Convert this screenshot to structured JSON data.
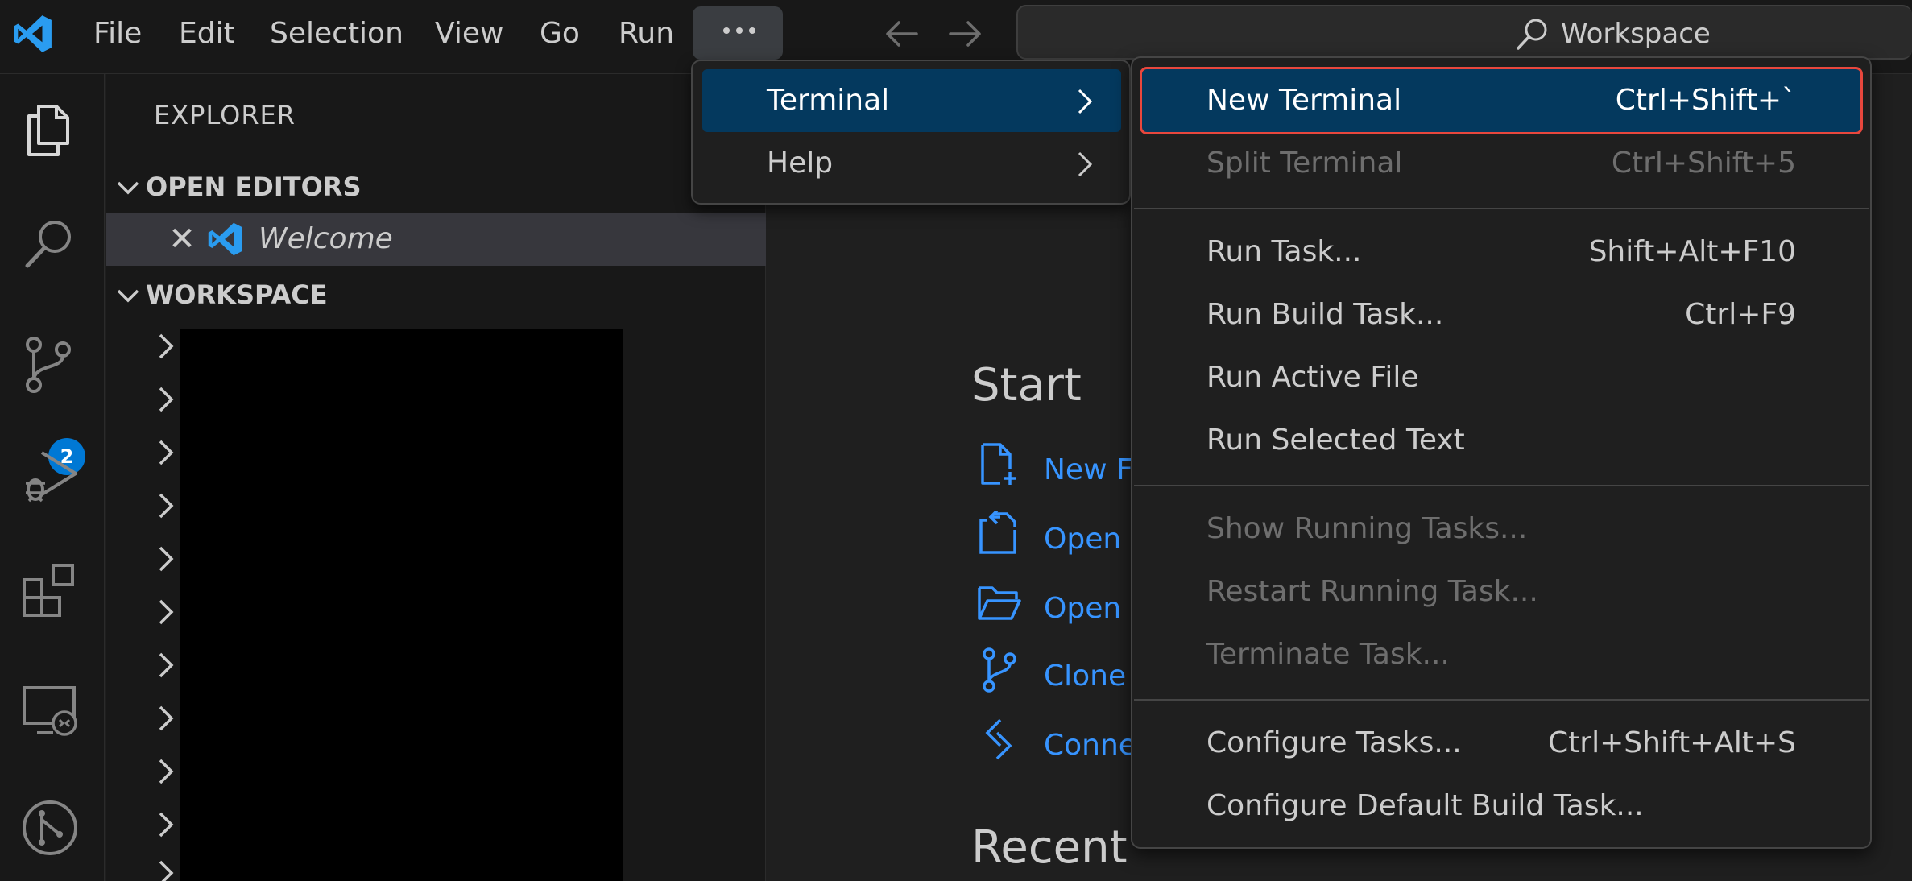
{
  "colors": {
    "accent": "#0078d4",
    "link": "#3794ff",
    "menu_highlight": "#04395e",
    "focus_outline": "#e8473d"
  },
  "titlebar": {
    "menus": [
      "File",
      "Edit",
      "Selection",
      "View",
      "Go",
      "Run"
    ],
    "search_label": "Workspace"
  },
  "activitybar": {
    "icons": [
      "explorer-icon",
      "search-icon",
      "source-control-icon",
      "run-debug-icon",
      "extensions-icon",
      "remote-explorer-icon",
      "git-graph-icon"
    ],
    "scm_badge": "2"
  },
  "sidebar": {
    "title": "EXPLORER",
    "open_editors_label": "OPEN EDITORS",
    "open_editor_item": "Welcome",
    "workspace_label": "WORKSPACE"
  },
  "welcome": {
    "start_heading": "Start",
    "links": [
      "New F",
      "Open",
      "Open",
      "Clone",
      "Conne"
    ],
    "recent_heading": "Recent"
  },
  "more_menu": {
    "items": [
      {
        "label": "Terminal"
      },
      {
        "label": "Help"
      }
    ]
  },
  "terminal_menu": {
    "items": [
      {
        "label": "New Terminal",
        "shortcut": "Ctrl+Shift+`"
      },
      {
        "label": "Split Terminal",
        "shortcut": "Ctrl+Shift+5"
      },
      {
        "label": "Run Task...",
        "shortcut": "Shift+Alt+F10"
      },
      {
        "label": "Run Build Task...",
        "shortcut": "Ctrl+F9"
      },
      {
        "label": "Run Active File",
        "shortcut": ""
      },
      {
        "label": "Run Selected Text",
        "shortcut": ""
      },
      {
        "label": "Show Running Tasks...",
        "shortcut": ""
      },
      {
        "label": "Restart Running Task...",
        "shortcut": ""
      },
      {
        "label": "Terminate Task...",
        "shortcut": ""
      },
      {
        "label": "Configure Tasks...",
        "shortcut": "Ctrl+Shift+Alt+S"
      },
      {
        "label": "Configure Default Build Task...",
        "shortcut": ""
      }
    ]
  }
}
